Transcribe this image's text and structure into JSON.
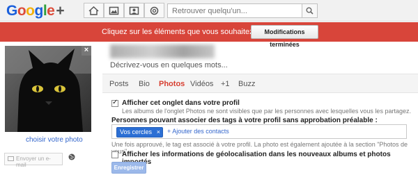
{
  "header": {
    "logo": {
      "g1": "G",
      "o1": "o",
      "o2": "o",
      "g2": "g",
      "l": "l",
      "e": "e",
      "plus": "+"
    },
    "nav_icons": [
      "home-icon",
      "photos-icon",
      "profile-icon",
      "circles-icon"
    ],
    "search": {
      "placeholder": "Retrouver quelqu'un..."
    }
  },
  "banner": {
    "message": "Cliquez sur les éléments que vous souhaitez modifier.",
    "done_button": "Modifications terminées"
  },
  "profile": {
    "choose_photo": "choisir votre photo",
    "email_button": "Envoyer un e-mail",
    "tagline": "Décrivez-vous en quelques mots..."
  },
  "tabs": [
    {
      "label": "Posts",
      "active": false
    },
    {
      "label": "Bio",
      "active": false
    },
    {
      "label": "Photos",
      "active": true
    },
    {
      "label": "Vidéos",
      "active": false
    },
    {
      "label": "+1",
      "active": false
    },
    {
      "label": "Buzz",
      "active": false
    }
  ],
  "photos_settings": {
    "show_tab": {
      "label": "Afficher cet onglet dans votre profil",
      "checked": true,
      "description": "Les albums de l'onglet Photos ne sont visibles que par les personnes avec lesquelles vous les partagez."
    },
    "tag_section_title": "Personnes pouvant associer des tags à votre profil sans approbation préalable :",
    "tag_chip": "Vos cercles",
    "add_contacts": "+ Ajouter des contacts",
    "tag_note": "Une fois approuvé, le tag est associé à votre profil. La photo est également ajoutée à la section \"Photos de vous\".",
    "geo": {
      "label": "Afficher les informations de géolocalisation dans les nouveaux albums et photos importés",
      "checked": false
    },
    "save_button": "Enregistrer"
  },
  "colors": {
    "accent_red": "#d8453a",
    "link_blue": "#3366cc",
    "chip_blue": "#2c6fd4"
  }
}
